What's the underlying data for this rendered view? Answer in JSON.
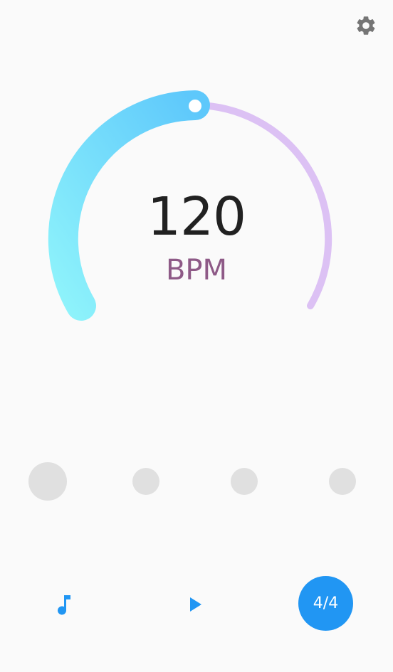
{
  "tempo": {
    "value": "120",
    "unit": "BPM"
  },
  "beats": {
    "count": 4,
    "accent_beat": 1
  },
  "controls": {
    "time_signature_label": "4/4"
  },
  "icons": {
    "settings": "gear-icon",
    "sound": "music-note-icon",
    "play": "play-icon"
  },
  "colors": {
    "accent": "#2196f3",
    "dial_active_start": "#8ef3fb",
    "dial_active_end": "#5ec8fb",
    "dial_inactive": "#dcc1f4",
    "unit_text": "#8e5a87",
    "beat_idle": "#e0e0e0",
    "icon_gray": "#757575"
  }
}
